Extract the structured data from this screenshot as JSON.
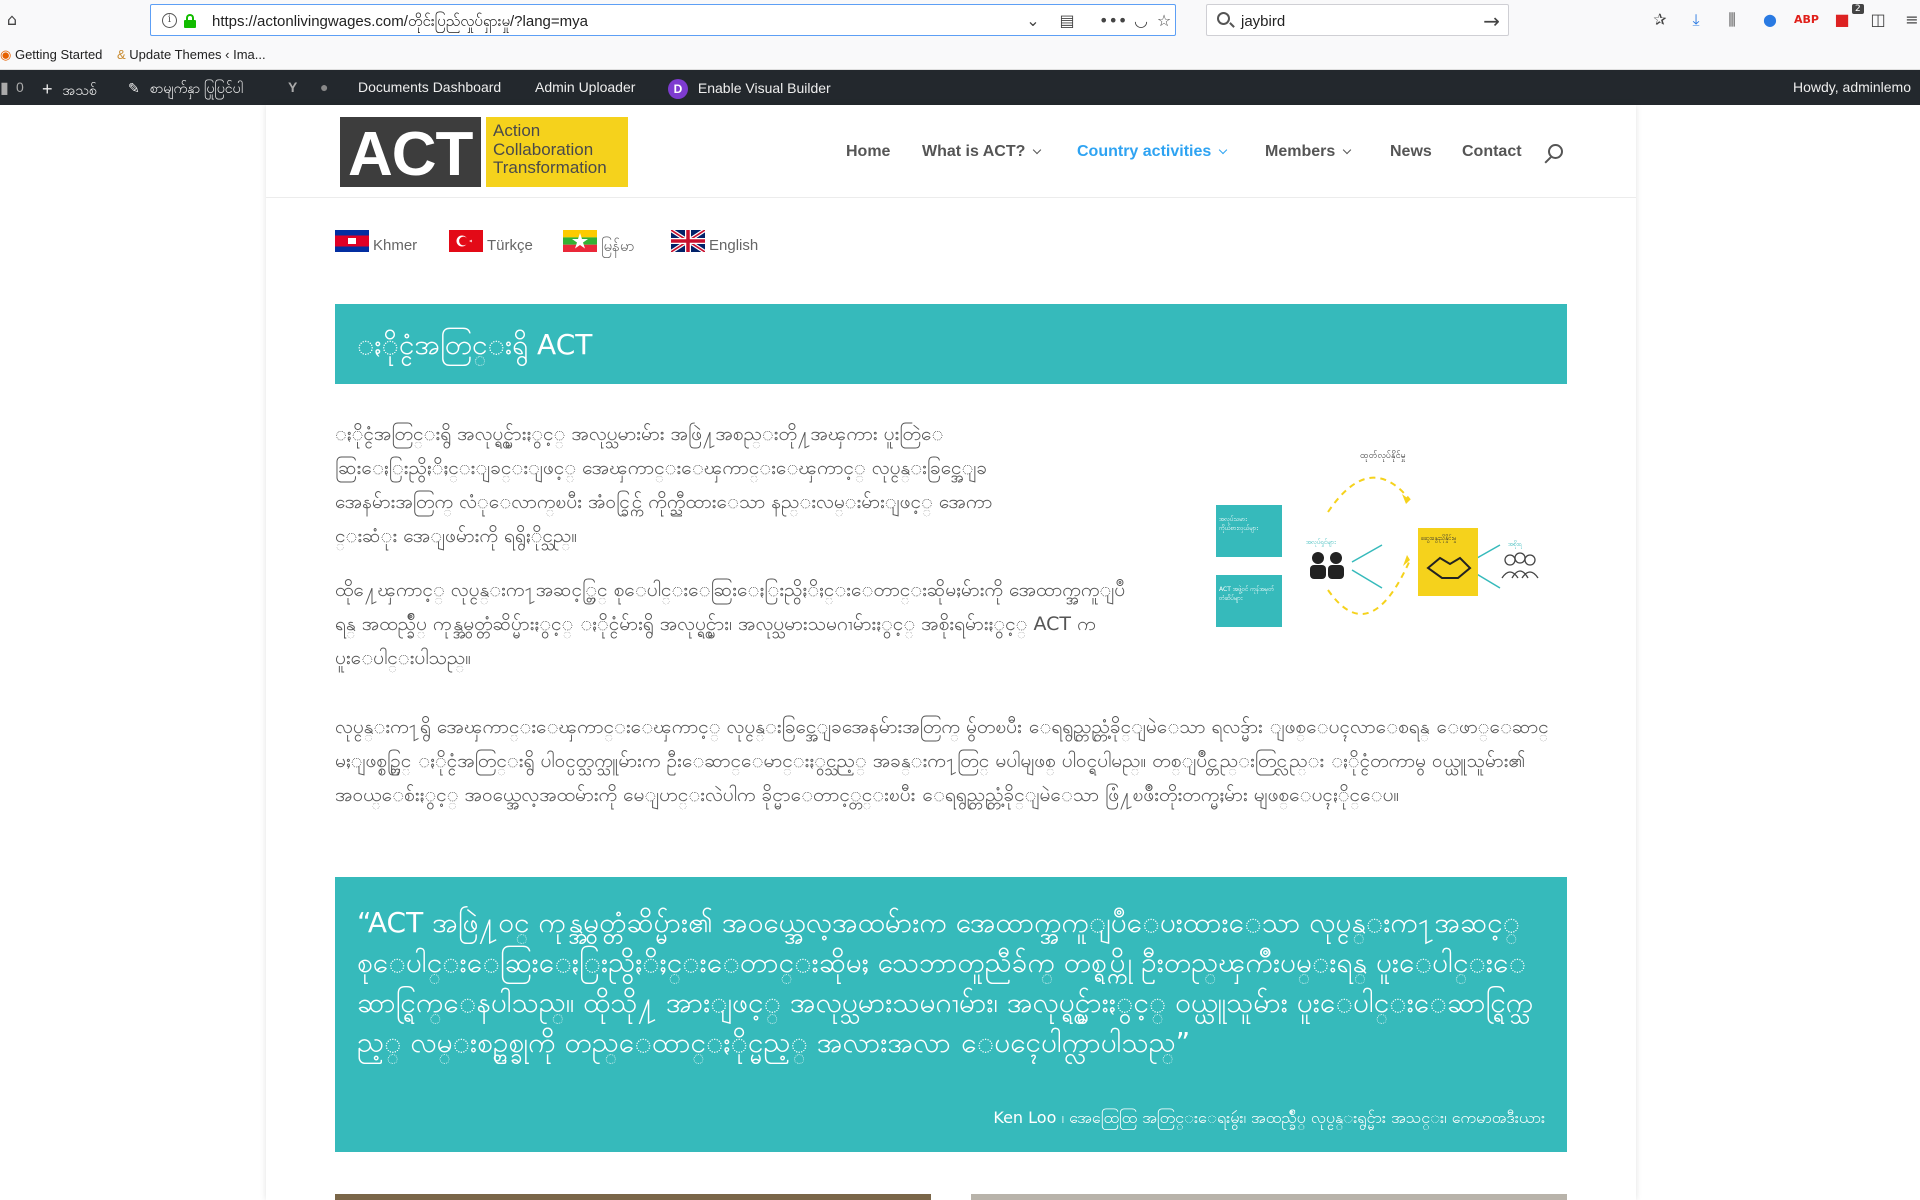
{
  "browser": {
    "url": "https://actonlivingwages.com/တိုင်းပြည်လှုပ်ရှားမှု/?lang=mya",
    "search_value": "jaybird",
    "bookmarks": [
      {
        "label": "Getting Started",
        "icon": "firefox-icon"
      },
      {
        "label": "Update Themes ‹ Ima...",
        "icon": "wordpress-icon"
      }
    ]
  },
  "admin_bar": {
    "count": "0",
    "new_label": "အသစ်",
    "edit_label": "စာမျက်နှာ ပြုပြင်ပါ",
    "documents_label": "Documents Dashboard",
    "uploader_label": "Admin Uploader",
    "visual_builder_label": "Enable Visual Builder",
    "greeting": "Howdy, adminlemo"
  },
  "site": {
    "logo_main": "ACT",
    "logo_words": [
      "Action",
      "Collaboration",
      "Transformation"
    ],
    "nav": [
      {
        "label": "Home",
        "has_dropdown": false,
        "active": false
      },
      {
        "label": "What is ACT?",
        "has_dropdown": true,
        "active": false
      },
      {
        "label": "Country activities",
        "has_dropdown": true,
        "active": true
      },
      {
        "label": "Members",
        "has_dropdown": true,
        "active": false
      },
      {
        "label": "News",
        "has_dropdown": false,
        "active": false
      },
      {
        "label": "Contact",
        "has_dropdown": false,
        "active": false
      }
    ],
    "languages": [
      {
        "label": "Khmer",
        "flag": "cambodia-flag-icon"
      },
      {
        "label": "Türkçe",
        "flag": "turkey-flag-icon"
      },
      {
        "label": "မြန်မာ",
        "flag": "myanmar-flag-icon"
      },
      {
        "label": "English",
        "flag": "uk-flag-icon"
      }
    ]
  },
  "content": {
    "title": "ႏိုင္ငံအတြင္းရွိ ACT",
    "para1": "ႏိုင္ငံအတြင္းရွိ အလုပ္ရွင္မ်ားႏွင့္ အလုပ္သမားမ်ား အဖြဲ႔အစည္းတို႔အၾကား ပူးတြဲေဆြးေႏြးညွိႏိႈင္းျခင္းျဖင့္ အေၾကာင္းေၾကာင္းေၾကာင့္ လုပ္ငန္းခြင္အေျခအေနမ်ားအတြက္ လံုေလာက္ၿပီး အံ၀င္ခြင္က် ကိုက္ညီထားေသာ နည္းလမ္းမ်ားျဖင့္ အေကာင္းဆံုး အေျဖမ်ားကို ရရွိႏိုင္သည္။",
    "para2": "ထို႔ေၾကာင့္ လုပ္ငန္းက႑အဆင့္တြင္ စုေပါင္းေဆြးေႏြးညွိႏိႈင္းေတာင္းဆိုမႈမ်ားကို အေထာက္အကူျပဳရန္ အထည္ခ်ဳပ္ ကုန္အမွတ္တံဆိပ္မ်ားႏွင့္ ႏိုင္ငံမ်ားရွိ အလုပ္ရွင္မ်ား၊ အလုပ္သမားသမဂၢမ်ားႏွင့္ အစိုးရမ်ားႏွင့္ ACT က ပူးေပါင္းပါသည္။",
    "para3": "လုပ္ငန္းက႑ရွိ အေၾကာင္းေၾကာင္းေၾကာင့္ လုပ္ငန္းခြင္အေျခအေနမ်ားအတြက္ မွ်တၿပီး ေရရွည္တည္တံ့ခိုင္ျမဲေသာ ရလဒ္မ်ား ျဖစ္ေပၚလာေစရန္ ေဖာ္ေဆာင္မႈျဖစ္စဥ္တြင္ ႏိုင္ငံအတြင္းရွိ ပါ၀င္ပတ္သက္သူမ်ားက ဦးေဆာင္ေမာင္းႏွင္သည့္ အခန္းက႑တြင္ မပါမျဖစ္ ပါ၀င္ရပါမည္။ တစ္ျပိဳင္တည္းတြင္လည္း ႏိုင္ငံတကာမွ ၀ယ္ယူသူမ်ား၏ အ၀ယ္ေစ်းႏွင့္ အ၀ယ္အေလ့အထမ်ားကို မေျပာင္းလဲပါက ခိုင္မာေတာင့္တင္းၿပီး ေရရွည္တည္တံ့ခိုင္ျမဲေသာ ဖြံ႔ၿဖိဳးတိုးတက္မႈမ်ား မျဖစ္ေပၚႏိုင္ေပ။",
    "diagram": {
      "heading": "ထုတ်လုပ်နိုင်မှု",
      "box1": "အလုပ်သမား ကိုယ်စားလှယ်များ",
      "box2": "ACT အဖွဲ့ဝင် ကုန်အမှတ်တံဆိပ်များ",
      "center_label": "ဆွေးနွေးညှိနှိုင်းမှု",
      "people_label": "အလုပ်ရှင်များ",
      "group_label": "အစိုးရ"
    },
    "quote": "“ACT အဖြဲ႔၀င္ ကုန္အမွတ္တံဆိပ္မ်ား၏ အ၀ယ္အေလ့အထမ်ားက အေထာက္အကူျပဳေပးထားေသာ လုပ္ငန္းက႑အဆင့္ စုေပါင္းေဆြးေႏြးညွိႏိႈင္းေတာင္းဆိုမႈ သေဘာတူညီခ်က္ တစ္ရပ္ကို ဦးတည္ၾကိဳးပမ္းရန္ ပူးေပါင္းေဆာင္ရြက္ေနပါသည္။ ထိုသို႔ အားျဖင့္ အလုပ္သမားသမဂၢမ်ား၊ အလုပ္ရွင္မ်ားႏွင့္ ၀ယ္ယူသူမ်ား ပူးေပါင္းေဆာင္ရြက္သည့္ လမ္းစဥ္တစ္ခုကို တည္ေထာင္ႏိုင္မည့္ အလားအလာ ေပၚေပါက္လာပါသည္”",
    "quote_author": "Ken Loo ၊ အေထြေထြ အတြင္းေရးမွဴး၊ အထည္ခ်ဳပ္ လုပ္ငန္းရွင္မ်ား အသင္း၊ ကေမာၻဒီးယား"
  },
  "colors": {
    "accent": "#36babb",
    "nav_active": "#2ea3f2",
    "logo_yellow": "#f5d21c",
    "logo_dark": "#3d3d3d",
    "admin_bar": "#23282d"
  }
}
